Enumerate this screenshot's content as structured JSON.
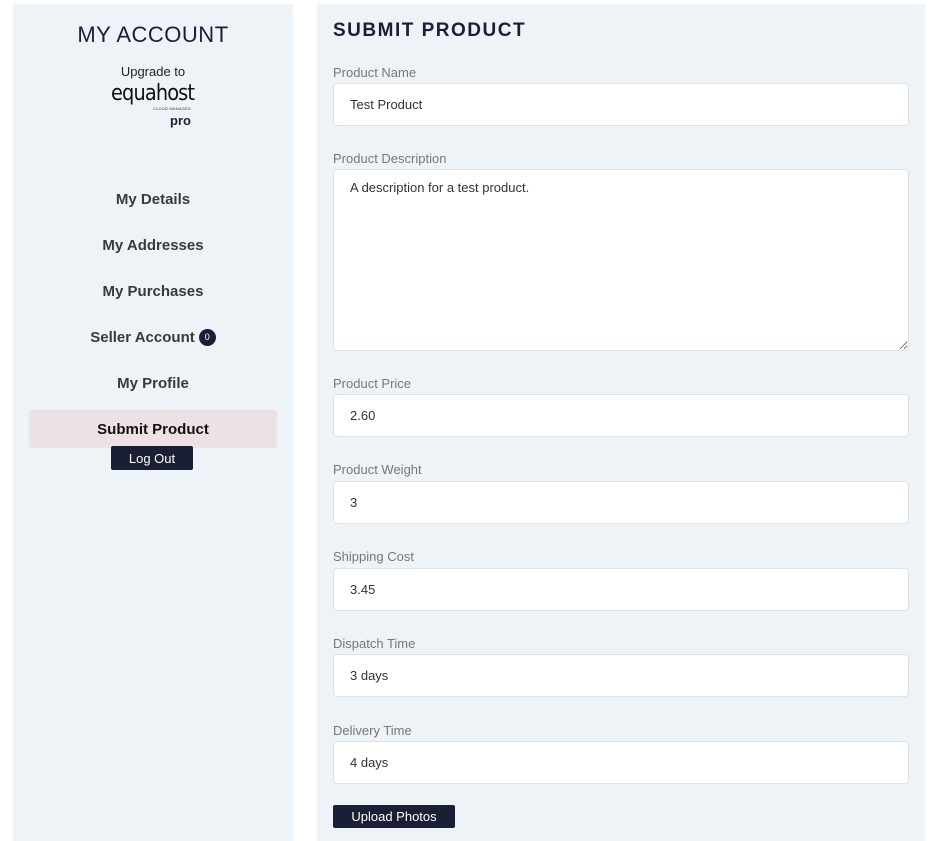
{
  "sidebar": {
    "title": "MY ACCOUNT",
    "upgrade": {
      "label": "Upgrade to",
      "brand_name": "equahost",
      "brand_tagline": "CLOUD MANAGED",
      "brand_tier": "pro"
    },
    "nav": [
      {
        "label": "My Details"
      },
      {
        "label": "My Addresses"
      },
      {
        "label": "My Purchases"
      },
      {
        "label": "Seller Account",
        "badge": "0"
      },
      {
        "label": "My Profile"
      },
      {
        "label": "Submit Product",
        "active": true
      }
    ],
    "logout_label": "Log Out"
  },
  "main": {
    "title": "SUBMIT PRODUCT",
    "fields": {
      "product_name": {
        "label": "Product Name",
        "value": "Test Product"
      },
      "product_description": {
        "label": "Product Description",
        "value": "A description for a test product."
      },
      "product_price": {
        "label": "Product Price",
        "value": "2.60"
      },
      "product_weight": {
        "label": "Product Weight",
        "value": "3"
      },
      "shipping_cost": {
        "label": "Shipping Cost",
        "value": "3.45"
      },
      "dispatch_time": {
        "label": "Dispatch Time",
        "value": "3 days"
      },
      "delivery_time": {
        "label": "Delivery Time",
        "value": "4 days"
      }
    },
    "upload_label": "Upload Photos"
  },
  "colors": {
    "panel_bg": "#eef3f8",
    "accent_dark": "#1b1f36",
    "active_nav_bg": "#ece2e3"
  }
}
